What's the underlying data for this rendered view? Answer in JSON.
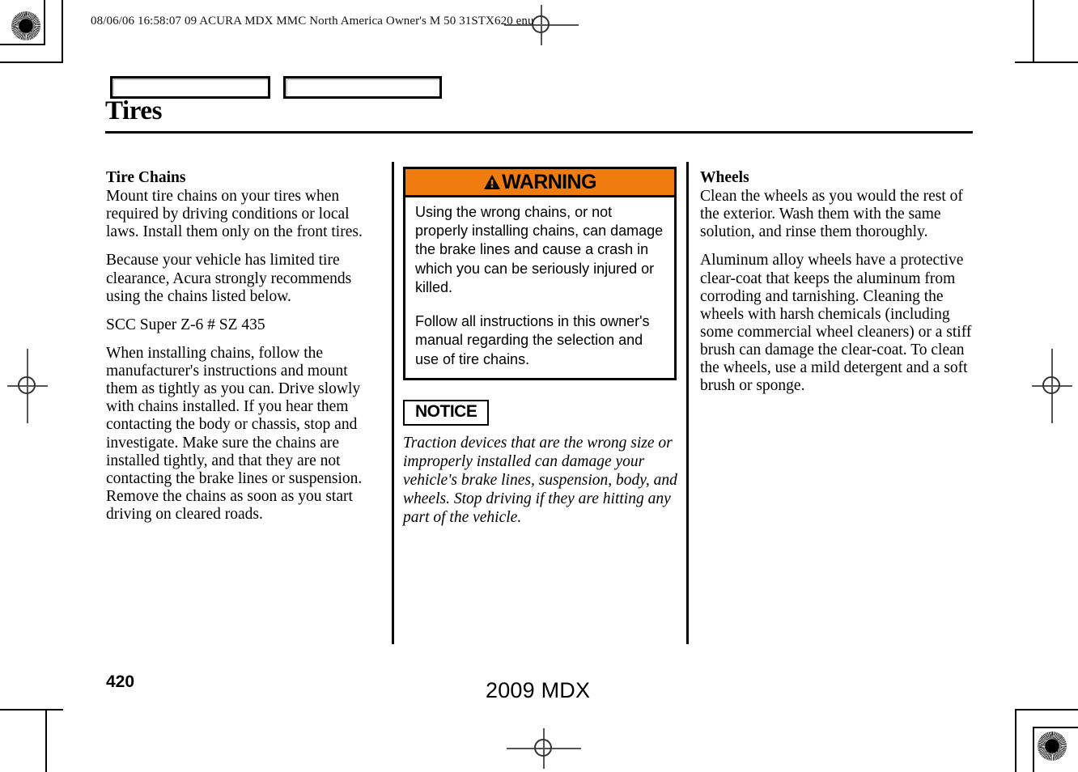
{
  "header": {
    "print_stamp": "08/06/06 16:58:07   09 ACURA MDX MMC North America Owner's M 50 31STX620 enu"
  },
  "tabs": [
    {
      "label": ""
    },
    {
      "label": ""
    }
  ],
  "page_title": "Tires",
  "left_column": {
    "heading": "Tire Chains",
    "paragraphs": [
      "Mount tire chains on your tires when required by driving conditions or local laws. Install them only on the front tires.",
      "Because your vehicle has limited tire clearance, Acura strongly recommends using the chains listed below.",
      "SCC Super Z-6 # SZ 435",
      "When installing chains, follow the manufacturer's instructions and mount them as tightly as you can. Drive slowly with chains installed. If you hear them contacting the body or chassis, stop and investigate. Make sure the chains are installed tightly, and that they are not contacting the brake lines or suspension. Remove the chains as soon as you start driving on cleared roads."
    ]
  },
  "warning": {
    "icon": "warning-triangle-icon",
    "title": "WARNING",
    "bar_color": "#F07C10",
    "paragraphs": [
      "Using the wrong chains, or not properly installing chains, can damage the brake lines and cause a crash in which you can be seriously injured or killed.",
      "Follow all instructions in this owner's manual regarding the selection and use of tire chains."
    ]
  },
  "notice": {
    "label": "NOTICE",
    "text": "Traction devices that are the wrong size or improperly installed can damage your vehicle's brake lines, suspension, body, and wheels. Stop driving if they are hitting any part of the vehicle."
  },
  "right_column": {
    "heading": "Wheels",
    "paragraphs": [
      "Clean the wheels as you would the rest of the exterior. Wash them with the same solution, and rinse them thoroughly.",
      "Aluminum alloy wheels have a protective clear-coat that keeps the aluminum from corroding and tarnishing. Cleaning the wheels with harsh chemicals (including some commercial wheel cleaners) or a stiff brush can damage the clear-coat. To clean the wheels, use a mild detergent and a soft brush or sponge."
    ]
  },
  "footer": {
    "page_number": "420",
    "model_year": "2009  MDX"
  }
}
